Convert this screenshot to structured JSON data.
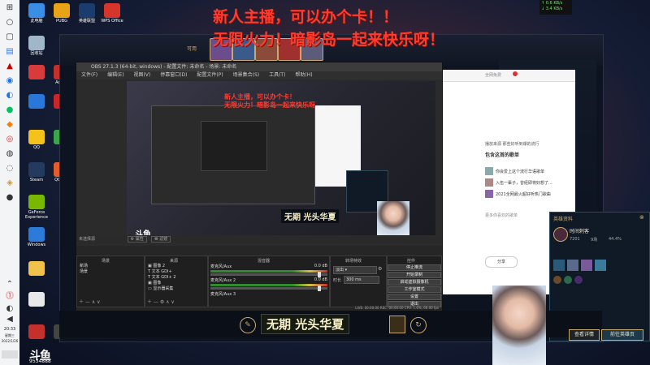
{
  "overlay": {
    "line1": "新人主播，可以办个卡！！",
    "line2": "无限火力！暗影岛一起来快乐呀！",
    "mini_line1": "新人主播，可以办个卡！",
    "mini_line2": "无限火力！暗影岛一起来快乐呀"
  },
  "network": {
    "up": "↑ 0.6 KB/s",
    "down": "↓ 3.4 KB/s"
  },
  "desktop_icons": [
    {
      "label": "此电脑"
    },
    {
      "label": "PUBG"
    },
    {
      "label": "英雄联盟"
    },
    {
      "label": "WPS Office"
    },
    {
      "label": "回收站"
    },
    {
      "label": ""
    },
    {
      "label": "Adobe"
    },
    {
      "label": "QQ"
    },
    {
      "label": "Steam"
    },
    {
      "label": "QQ游戏"
    },
    {
      "label": "GeForce Experience"
    },
    {
      "label": "Windows"
    }
  ],
  "taskbar": {
    "time": "20:33",
    "weekday": "星期三",
    "date": "2022/1/26",
    "douyu_id": "9534888"
  },
  "game": {
    "status_label": "可用"
  },
  "obs": {
    "title": "OBS 27.1.3 (64-bit, windows) - 配置文件: 未命名 - 场景: 未命名",
    "menus": [
      "文件(F)",
      "编辑(E)",
      "视图(V)",
      "停靠窗口(D)",
      "配置文件(P)",
      "场景集合(S)",
      "工具(T)",
      "帮助(H)"
    ],
    "source_label": "未选择源",
    "props_btn": "属性",
    "filters_btn": "滤镜",
    "panels": {
      "scenes": "场景",
      "sources": "来源",
      "mixer": "混音器",
      "transitions": "转场特效",
      "controls": "控件"
    },
    "scenes": [
      "新场",
      "场景"
    ],
    "sources": [
      "图像 2",
      "文本 GDI+",
      "文本 GDI+ 2",
      "图像",
      "显示器采集"
    ],
    "mixer": [
      {
        "name": "麦克风/Aux",
        "db": "0.0 dB"
      },
      {
        "name": "麦克风/Aux 2",
        "db": "0.0 dB"
      },
      {
        "name": "麦克风/Aux 3",
        "db": ""
      }
    ],
    "transition": "淡出",
    "duration_label": "时长",
    "duration": "300 ms",
    "controls": [
      "停止推流",
      "开始录制",
      "启动虚拟摄像机",
      "工作室模式",
      "设置",
      "退出"
    ],
    "status": "LIVE: 00:00:00   REC: 00:00:00   CPU: 1.6%, 60.00 fps",
    "preview_caption": "无期 光头华夏"
  },
  "browser": {
    "title": "全网免费",
    "desc": "播放来源  那些好听到爆的流行",
    "heading": "包含这首的歌单",
    "items": [
      "你会爱上这个流行华语歌单",
      "入伍一辈子，曾经即将好想了...",
      "2021全网最火超好听热门歌曲"
    ],
    "more": "更多你喜欢的歌单",
    "share": "分享"
  },
  "stats": {
    "title": "英雄资料",
    "champion": "时间刺客",
    "games": "7201",
    "wins": "9场",
    "winrate": "44.4%"
  },
  "gamebar": {
    "caption": "无期  光头华夏",
    "btn_left": "查看详情",
    "btn_right": "前往英雄页"
  }
}
